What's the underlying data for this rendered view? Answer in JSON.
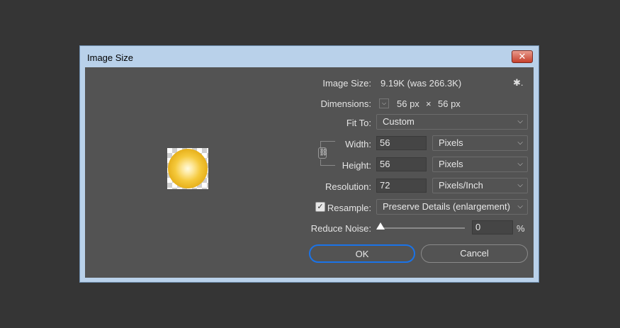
{
  "dialog": {
    "title": "Image Size",
    "close_glyph": "✕"
  },
  "info": {
    "image_size_label": "Image Size:",
    "image_size_value": "9.19K (was 266.3K)",
    "gear_glyph": "✱.",
    "dimensions_label": "Dimensions:",
    "dimensions_width": "56 px",
    "dimensions_times": "×",
    "dimensions_height": "56 px"
  },
  "fit_to": {
    "label": "Fit To:",
    "value": "Custom"
  },
  "width": {
    "label": "Width:",
    "value": "56",
    "unit": "Pixels"
  },
  "height": {
    "label": "Height:",
    "value": "56",
    "unit": "Pixels"
  },
  "resolution": {
    "label": "Resolution:",
    "value": "72",
    "unit": "Pixels/Inch"
  },
  "resample": {
    "checked": true,
    "check_glyph": "✓",
    "label": "Resample:",
    "value": "Preserve Details (enlargement)"
  },
  "reduce_noise": {
    "label": "Reduce Noise:",
    "value": "0",
    "unit": "%",
    "level": 0
  },
  "buttons": {
    "ok": "OK",
    "cancel": "Cancel"
  },
  "icons": {
    "chevron": "⌵",
    "chain": "⛓"
  },
  "colors": {
    "ok_border": "#1a73e8",
    "panel_bg": "#535353",
    "field_bg": "#454545",
    "frame": "#b9d1ea"
  }
}
